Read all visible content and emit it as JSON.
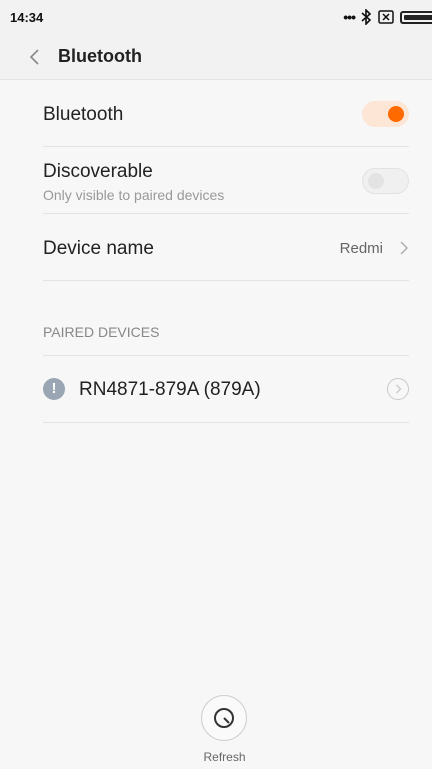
{
  "status_bar": {
    "time": "14:34",
    "icons": [
      "more-dots-icon",
      "bluetooth-icon",
      "no-sim-icon",
      "battery-icon"
    ]
  },
  "header": {
    "back_icon": "chevron-left-icon",
    "title": "Bluetooth"
  },
  "settings": {
    "bluetooth": {
      "label": "Bluetooth",
      "enabled": true
    },
    "discoverable": {
      "label": "Discoverable",
      "sublabel": "Only visible to paired devices",
      "enabled": false
    },
    "device_name": {
      "label": "Device name",
      "value": "Redmi"
    }
  },
  "paired": {
    "header": "PAIRED DEVICES",
    "devices": [
      {
        "name": "RN4871-879A (879A)",
        "icon": "exclamation-info-icon",
        "detail_icon": "chevron-right-circle-icon"
      }
    ]
  },
  "footer": {
    "refresh_label": "Refresh",
    "refresh_icon": "refresh-icon"
  },
  "colors": {
    "accent": "#ff6a00",
    "toggle_on_track": "#fde6d6",
    "background": "#f7f7f7",
    "device_icon": "#9aa6b4"
  }
}
